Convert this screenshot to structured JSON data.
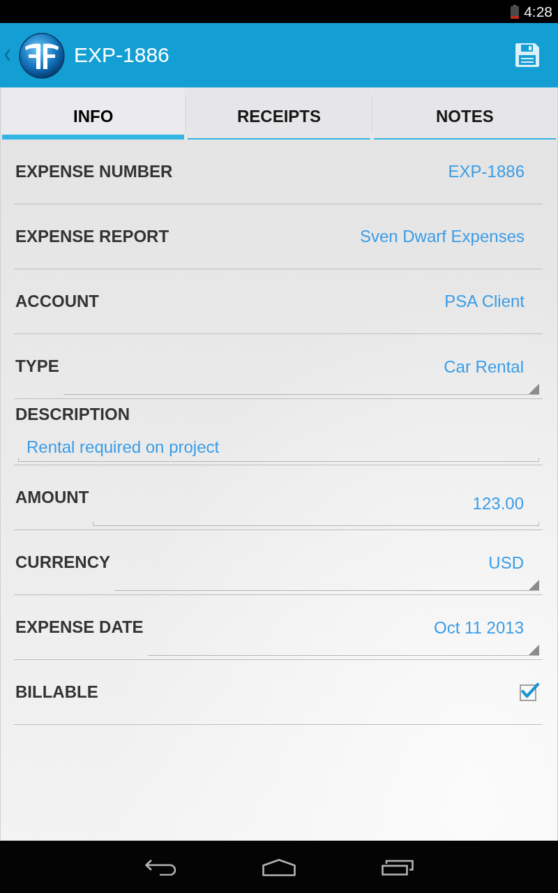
{
  "status_bar": {
    "time": "4:28"
  },
  "app_bar": {
    "title": "EXP-1886"
  },
  "tabs": [
    {
      "label": "INFO",
      "selected": true
    },
    {
      "label": "RECEIPTS",
      "selected": false
    },
    {
      "label": "NOTES",
      "selected": false
    }
  ],
  "fields": [
    {
      "kind": "text",
      "label": "EXPENSE NUMBER",
      "value": "EXP-1886"
    },
    {
      "kind": "text",
      "label": "EXPENSE REPORT",
      "value": "Sven Dwarf Expenses"
    },
    {
      "kind": "text",
      "label": "ACCOUNT",
      "value": "PSA Client"
    },
    {
      "kind": "spinner",
      "label": "TYPE",
      "value": "Car Rental"
    },
    {
      "kind": "multiline",
      "label": "DESCRIPTION",
      "value": "Rental required on project"
    },
    {
      "kind": "number",
      "label": "AMOUNT",
      "value": "123.00"
    },
    {
      "kind": "spinner",
      "label": "CURRENCY",
      "value": "USD"
    },
    {
      "kind": "spinner",
      "label": "EXPENSE DATE",
      "value": "Oct 11 2013"
    },
    {
      "kind": "checkbox",
      "label": "BILLABLE",
      "checked": true
    }
  ]
}
